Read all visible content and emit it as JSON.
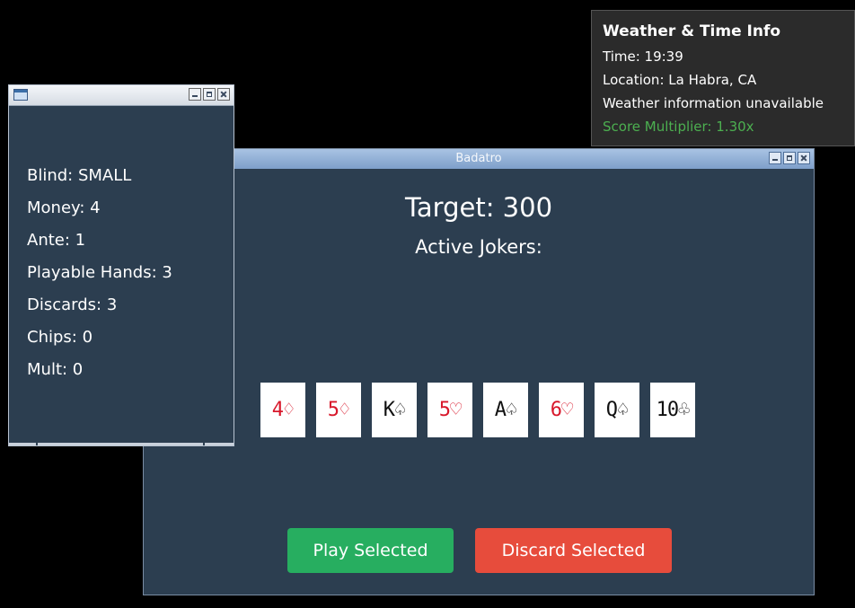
{
  "main_window": {
    "title": "Badatro",
    "target": "Target: 300",
    "jokers_label": "Active Jokers:",
    "cards": [
      {
        "text": "4♢",
        "color": "red"
      },
      {
        "text": "5♢",
        "color": "red"
      },
      {
        "text": "K♤",
        "color": "black"
      },
      {
        "text": "5♡",
        "color": "red"
      },
      {
        "text": "A♤",
        "color": "black"
      },
      {
        "text": "6♡",
        "color": "red"
      },
      {
        "text": "Q♤",
        "color": "black"
      },
      {
        "text": "10♧",
        "color": "black"
      }
    ],
    "play_label": "Play Selected",
    "discard_label": "Discard Selected",
    "colors": {
      "background": "#2c3e50",
      "play": "#27ae60",
      "discard": "#e74c3c",
      "red_suit": "#d8182b"
    }
  },
  "stats_window": {
    "items": [
      "Blind: SMALL",
      "Money: 4",
      "Ante: 1",
      "Playable Hands: 3",
      "Discards: 3",
      "Chips: 0",
      "Mult: 0"
    ]
  },
  "info_panel": {
    "title": "Weather & Time Info",
    "time": "Time: 19:39",
    "location": "Location: La Habra, CA",
    "weather": "Weather information unavailable",
    "multiplier": "Score Multiplier: 1.30x",
    "multiplier_color": "#4caf50"
  },
  "icons": {
    "window_controls": [
      "minimize-icon",
      "maximize-icon",
      "close-icon"
    ],
    "app": "window-app-icon"
  }
}
